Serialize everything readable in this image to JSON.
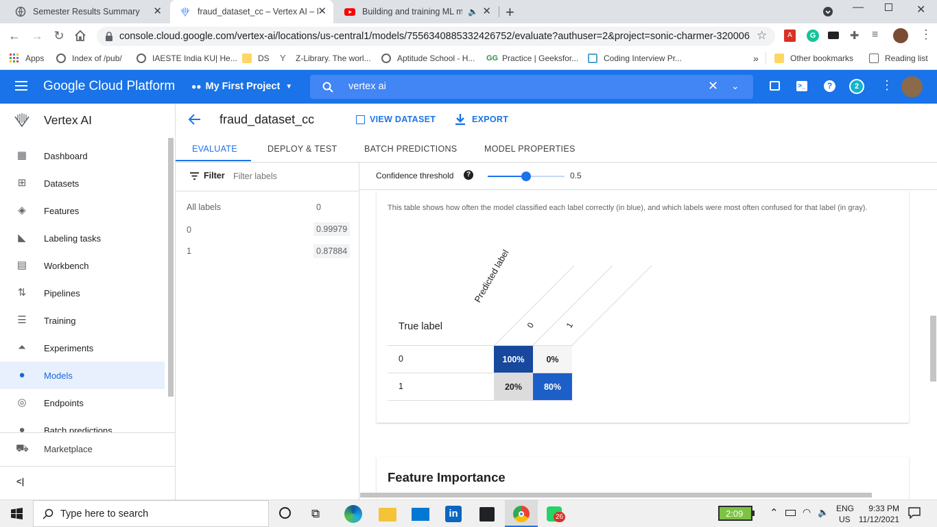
{
  "browser": {
    "tabs": [
      {
        "title": "Semester Results Summary"
      },
      {
        "title": "fraud_dataset_cc – Vertex AI – My"
      },
      {
        "title": "Building and training ML mo"
      }
    ],
    "url": "console.cloud.google.com/vertex-ai/locations/us-central1/models/7556340885332426752/evaluate?authuser=2&project=sonic-charmer-320006",
    "bookmarks": [
      {
        "label": "Apps"
      },
      {
        "label": "Index of /pub/"
      },
      {
        "label": "IAESTE India KU| He..."
      },
      {
        "label": "DS"
      },
      {
        "label": "Z-Library. The worl..."
      },
      {
        "label": "Aptitude School - H..."
      },
      {
        "label": "Practice | Geeksfor..."
      },
      {
        "label": "Coding Interview Pr..."
      },
      {
        "label": "»"
      },
      {
        "label": "Other bookmarks"
      },
      {
        "label": "Reading list"
      }
    ]
  },
  "gcp": {
    "title": "Google Cloud Platform",
    "project": "My First Project",
    "search_value": "vertex ai",
    "notifications": "2"
  },
  "sidebar": {
    "product": "Vertex AI",
    "items": [
      {
        "label": "Dashboard",
        "icon": "dashboard-icon"
      },
      {
        "label": "Datasets",
        "icon": "table-icon"
      },
      {
        "label": "Features",
        "icon": "layers-icon"
      },
      {
        "label": "Labeling tasks",
        "icon": "tag-icon"
      },
      {
        "label": "Workbench",
        "icon": "document-icon"
      },
      {
        "label": "Pipelines",
        "icon": "pipeline-icon"
      },
      {
        "label": "Training",
        "icon": "list-icon"
      },
      {
        "label": "Experiments",
        "icon": "flask-icon"
      },
      {
        "label": "Models",
        "icon": "lightbulb-icon"
      },
      {
        "label": "Endpoints",
        "icon": "target-icon"
      },
      {
        "label": "Batch predictions",
        "icon": "batch-icon"
      }
    ],
    "marketplace": "Marketplace",
    "collapse": "<|"
  },
  "page": {
    "title": "fraud_dataset_cc",
    "view_dataset": "VIEW DATASET",
    "export": "EXPORT",
    "tabs": [
      {
        "label": "EVALUATE"
      },
      {
        "label": "DEPLOY & TEST"
      },
      {
        "label": "BATCH PREDICTIONS"
      },
      {
        "label": "MODEL PROPERTIES"
      }
    ],
    "filter_label": "Filter",
    "filter_placeholder": "Filter labels",
    "labels": [
      {
        "name": "All labels",
        "value": "0"
      },
      {
        "name": "0",
        "value": "0.99979"
      },
      {
        "name": "1",
        "value": "0.87884"
      }
    ],
    "confidence_label": "Confidence threshold",
    "confidence_value": "0.5",
    "confidence_fraction": 0.5,
    "description": "This table shows how often the model classified each label correctly (in blue), and which labels were most often confused for that label (in gray).",
    "confusion": {
      "predicted_label": "Predicted label",
      "true_label": "True label",
      "columns": [
        "0",
        "1"
      ],
      "rows": [
        {
          "label": "0",
          "cells": [
            "100%",
            "0%"
          ]
        },
        {
          "label": "1",
          "cells": [
            "20%",
            "80%"
          ]
        }
      ]
    },
    "feature_importance": "Feature Importance"
  },
  "taskbar": {
    "search_placeholder": "Type here to search",
    "battery": "2:09",
    "lang1": "ENG",
    "lang2": "US",
    "time": "9:33 PM",
    "date": "11/12/2021",
    "whatsapp_badge": "26"
  },
  "colors": {
    "gcp_blue": "#1a73e8",
    "cm_dark_blue": "#1a56b0",
    "cm_gray": "#dcdcdc"
  }
}
